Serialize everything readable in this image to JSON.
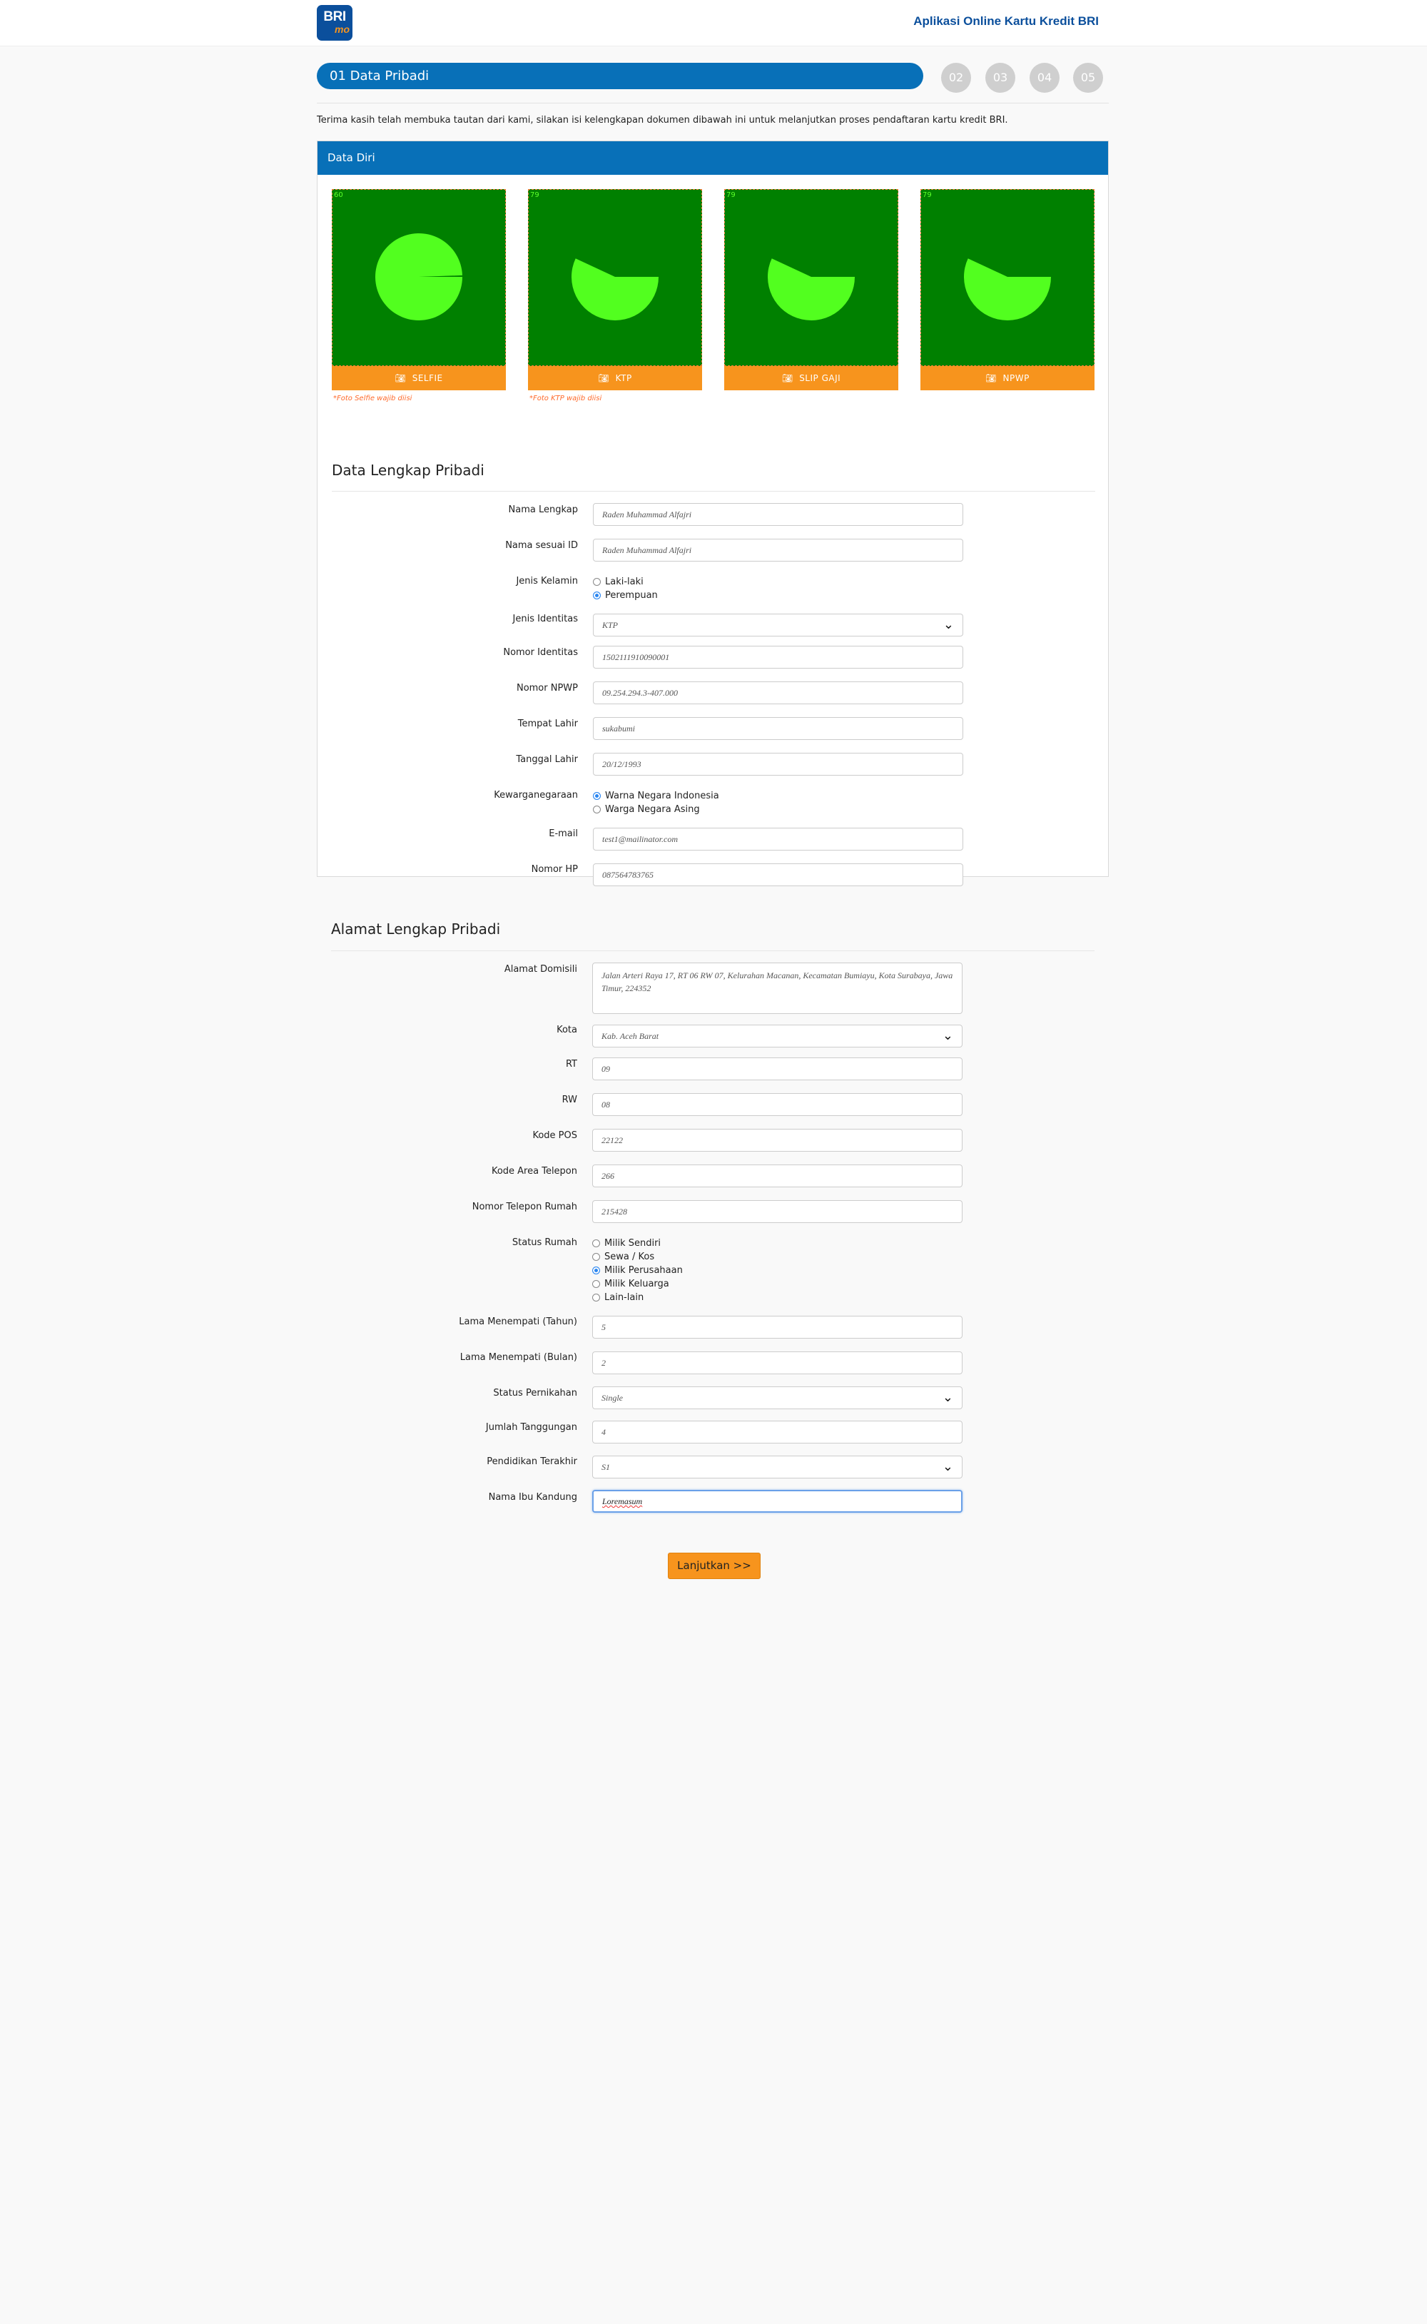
{
  "header": {
    "logo_line1": "BRI",
    "logo_line2": "mo",
    "app_title": "Aplikasi Online Kartu Kredit BRI"
  },
  "steps": {
    "active_label": "01 Data Pribadi",
    "others": [
      "02",
      "03",
      "04",
      "05"
    ]
  },
  "intro": "Terima kasih telah membuka tautan dari kami, silakan isi kelengkapan dokumen dibawah ini untuk melanjutkan proses pendaftaran kartu kredit BRI.",
  "card_title": "Data Diri",
  "photos": [
    {
      "number": "60",
      "button": "SELFIE",
      "note": "*Foto Selfie wajib diisi",
      "progress_deg": 358
    },
    {
      "number": "79",
      "button": "KTP",
      "note": "*Foto KTP wajib diisi",
      "progress_deg": 205
    },
    {
      "number": "79",
      "button": "SLIP GAJI",
      "note": "",
      "progress_deg": 205
    },
    {
      "number": "79",
      "button": "NPWP",
      "note": "",
      "progress_deg": 205
    }
  ],
  "sections": {
    "personal": "Data Lengkap Pribadi",
    "address": "Alamat Lengkap Pribadi"
  },
  "personal": {
    "nama_lengkap": {
      "label": "Nama Lengkap",
      "value": "Raden Muhammad Alfajri"
    },
    "nama_id": {
      "label": "Nama sesuai ID",
      "value": "Raden Muhammad Alfajri"
    },
    "jenis_kelamin": {
      "label": "Jenis Kelamin",
      "options": [
        "Laki-laki",
        "Perempuan"
      ],
      "selected": "Perempuan"
    },
    "jenis_identitas": {
      "label": "Jenis Identitas",
      "value": "KTP"
    },
    "nomor_identitas": {
      "label": "Nomor Identitas",
      "value": "1502111910090001"
    },
    "nomor_npwp": {
      "label": "Nomor NPWP",
      "value": "09.254.294.3-407.000"
    },
    "tempat_lahir": {
      "label": "Tempat Lahir",
      "value": "sukabumi"
    },
    "tanggal_lahir": {
      "label": "Tanggal Lahir",
      "value": "20/12/1993"
    },
    "kewarganegaraan": {
      "label": "Kewarganegaraan",
      "options": [
        "Warna Negara Indonesia",
        "Warga Negara Asing"
      ],
      "selected": "Warna Negara Indonesia"
    },
    "email": {
      "label": "E-mail",
      "value": "test1@mailinator.com"
    },
    "nomor_hp": {
      "label": "Nomor HP",
      "value": "087564783765"
    }
  },
  "address": {
    "alamat_domisili": {
      "label": "Alamat Domisili",
      "value": "Jalan Arteri Raya 17, RT 06 RW 07, Kelurahan Macanan, Kecamatan Bumiayu, Kota Surabaya, Jawa Timur, 224352"
    },
    "kota": {
      "label": "Kota",
      "value": "Kab. Aceh Barat"
    },
    "rt": {
      "label": "RT",
      "value": "09"
    },
    "rw": {
      "label": "RW",
      "value": "08"
    },
    "kode_pos": {
      "label": "Kode POS",
      "value": "22122"
    },
    "kode_area": {
      "label": "Kode Area Telepon",
      "value": "266"
    },
    "telepon_rumah": {
      "label": "Nomor Telepon Rumah",
      "value": "215428"
    },
    "status_rumah": {
      "label": "Status Rumah",
      "options": [
        "Milik Sendiri",
        "Sewa / Kos",
        "Milik Perusahaan",
        "Milik Keluarga",
        "Lain-lain"
      ],
      "selected": "Milik Perusahaan"
    },
    "lama_tahun": {
      "label": "Lama Menempati (Tahun)",
      "value": "5"
    },
    "lama_bulan": {
      "label": "Lama Menempati (Bulan)",
      "value": "2"
    },
    "status_pernikahan": {
      "label": "Status Pernikahan",
      "value": "Single"
    },
    "jumlah_tanggungan": {
      "label": "Jumlah Tanggungan",
      "value": "4"
    },
    "pendidikan": {
      "label": "Pendidikan Terakhir",
      "value": "S1"
    },
    "ibu_kandung": {
      "label": "Nama Ibu Kandung",
      "value": "Loremasum"
    }
  },
  "submit_label": "Lanjutkan >>",
  "colors": {
    "primary": "#0870b8",
    "accent": "#f7941d",
    "photo_bg": "#008000",
    "progress": "#52ff1f"
  },
  "icons": {
    "chevron": "chevron-down-icon",
    "camera": "camera-icon"
  }
}
